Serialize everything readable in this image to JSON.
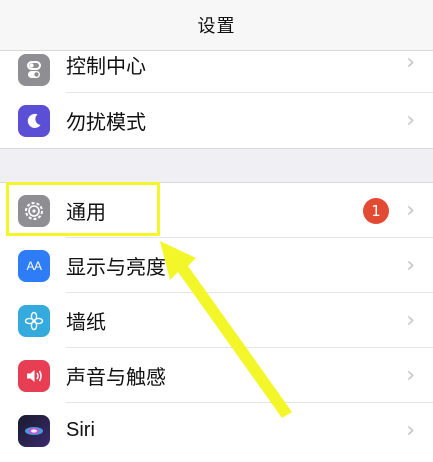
{
  "navbar": {
    "title": "设置"
  },
  "top_group": {
    "items": [
      {
        "label": "控制中心",
        "icon": "control-center-icon",
        "color": "#8e8e93"
      },
      {
        "label": "勿扰模式",
        "icon": "moon-icon",
        "color": "#5b4fd6"
      }
    ]
  },
  "bottom_group": {
    "items": [
      {
        "label": "通用",
        "icon": "gear-icon",
        "color": "#8e8e93",
        "badge": "1"
      },
      {
        "label": "显示与亮度",
        "icon": "display-brightness-icon",
        "color": "#2f7df6",
        "icon_text": "AA"
      },
      {
        "label": "墙纸",
        "icon": "wallpaper-icon",
        "color": "#35aadc"
      },
      {
        "label": "声音与触感",
        "icon": "sound-icon",
        "color": "#e83e54"
      },
      {
        "label": "Siri",
        "icon": "siri-icon",
        "color": "#222"
      }
    ]
  },
  "chevron": "›",
  "colors": {
    "highlight": "#f5f52a",
    "badge": "#e24a34"
  }
}
